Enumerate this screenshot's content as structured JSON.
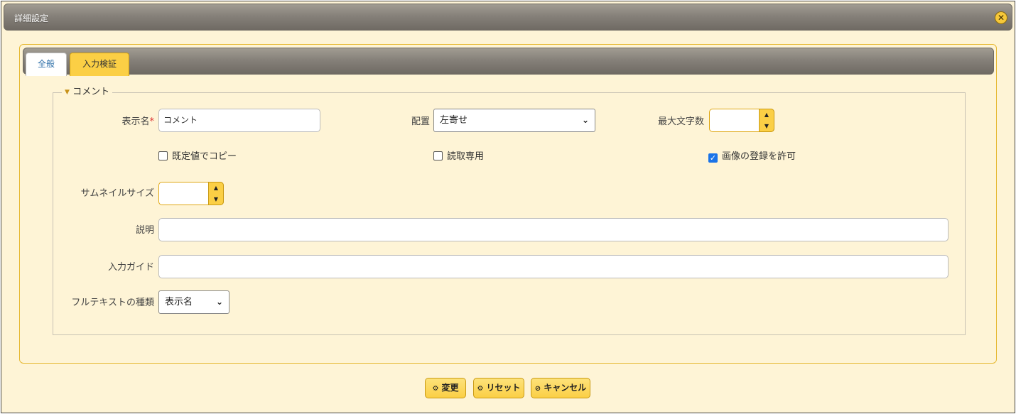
{
  "dialog": {
    "title": "詳細設定"
  },
  "tabs": [
    {
      "label": "全般",
      "active": true
    },
    {
      "label": "入力検証",
      "active": false
    }
  ],
  "section": {
    "legend": "コメント"
  },
  "fields": {
    "display_name": {
      "label": "表示名",
      "required_mark": "*",
      "value": "コメント"
    },
    "alignment": {
      "label": "配置",
      "value": "左寄せ"
    },
    "max_chars": {
      "label": "最大文字数",
      "value": ""
    },
    "thumbnail_size": {
      "label": "サムネイルサイズ",
      "value": ""
    },
    "description": {
      "label": "説明",
      "value": ""
    },
    "input_guide": {
      "label": "入力ガイド",
      "value": ""
    },
    "fulltext_type": {
      "label": "フルテキストの種類",
      "value": "表示名"
    }
  },
  "checkboxes": {
    "copy_default": {
      "label": "既定値でコピー",
      "checked": false
    },
    "read_only": {
      "label": "読取専用",
      "checked": false
    },
    "allow_image": {
      "label": "画像の登録を許可",
      "checked": true
    }
  },
  "buttons": {
    "change": "変更",
    "reset": "リセット",
    "cancel": "キャンセル"
  },
  "colors": {
    "dialog_bg": "#fef4d6",
    "accent_yellow": "#fbcf45",
    "titlebar_gray": "#86817a",
    "checkbox_blue": "#1a73e8",
    "required_red": "#dd3333"
  }
}
